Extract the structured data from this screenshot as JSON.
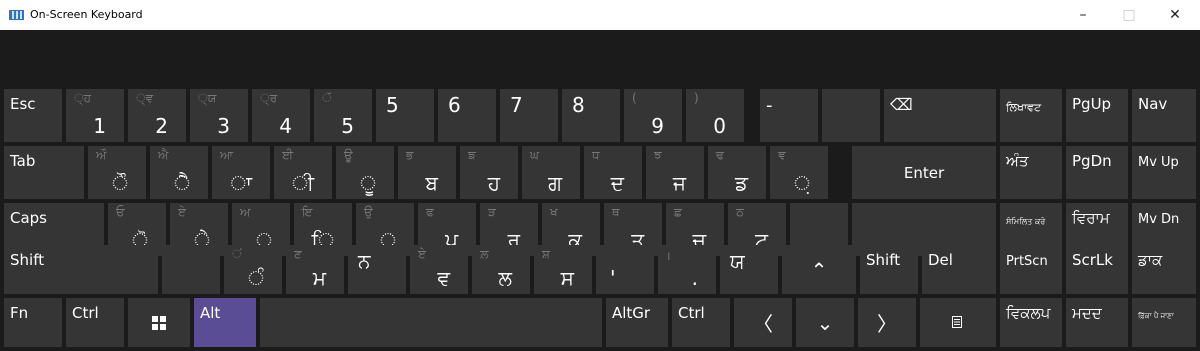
{
  "window": {
    "title": "On-Screen Keyboard",
    "minimize_glyph": "–",
    "maximize_glyph": "□",
    "close_glyph": "✕"
  },
  "keys": {
    "esc": "Esc",
    "digits": [
      {
        "shift": "੍ਹ",
        "main": "1"
      },
      {
        "shift": "੍ਵ",
        "main": "2"
      },
      {
        "shift": "੍ਯ",
        "main": "3"
      },
      {
        "shift": "੍ਰ",
        "main": "4"
      },
      {
        "shift": "ੱ",
        "main": "5"
      }
    ],
    "digits2": [
      {
        "main": "5"
      },
      {
        "main": "6"
      },
      {
        "main": "7"
      },
      {
        "main": "8"
      }
    ],
    "paren_open": "(",
    "nine": "9",
    "paren_close": ")",
    "zero": "0",
    "minus": "-",
    "tab": "Tab",
    "row2": [
      {
        "shift": "ਔ",
        "main": "ੌ"
      },
      {
        "shift": "ਐ",
        "main": "ੈ"
      },
      {
        "shift": "ਆ",
        "main": "ਾ"
      },
      {
        "shift": "ਈ",
        "main": "ੀ"
      },
      {
        "shift": "ਊ",
        "main": "ੂ"
      },
      {
        "shift": "ਭ",
        "main": "ਬ"
      },
      {
        "shift": "ਙ",
        "main": "ਹ"
      },
      {
        "shift": "ਘ",
        "main": "ਗ"
      },
      {
        "shift": "ਧ",
        "main": "ਦ"
      },
      {
        "shift": "ਝ",
        "main": "ਜ"
      },
      {
        "shift": "ਢ",
        "main": "ਡ"
      },
      {
        "shift": "ਞ",
        "main": "਼"
      }
    ],
    "enter": "Enter",
    "caps": "Caps",
    "row3": [
      {
        "shift": "ਓ",
        "main": "ੋ"
      },
      {
        "shift": "ਏ",
        "main": "ੇ"
      },
      {
        "shift": "ਅ",
        "main": "੍"
      },
      {
        "shift": "ਇ",
        "main": "ਿ"
      },
      {
        "shift": "ਉ",
        "main": "ੁ"
      },
      {
        "shift": "ਫ",
        "main": "ਪ"
      },
      {
        "shift": "ੜ",
        "main": "ਰ"
      },
      {
        "shift": "ਖ",
        "main": "ਕ"
      },
      {
        "shift": "ਥ",
        "main": "ਤ"
      },
      {
        "shift": "ਛ",
        "main": "ਚ"
      },
      {
        "shift": "ਠ",
        "main": "ਟ"
      }
    ],
    "shift": "Shift",
    "row4": [
      {
        "shift": "ਂ",
        "main": "ੰ"
      },
      {
        "shift": "ਣ",
        "main": "ਮ"
      },
      {
        "shift": "",
        "main": "ਨ"
      },
      {
        "shift": "ਏ",
        "main": "ਵ"
      },
      {
        "shift": "ਲ਼",
        "main": "ਲ"
      },
      {
        "shift": "ਸ਼",
        "main": "ਸ"
      },
      {
        "shift": "",
        "main": "'"
      },
      {
        "shift": "।",
        "main": "."
      },
      {
        "shift": "",
        "main": "ਯ"
      }
    ],
    "shift_right": "Shift",
    "del": "Del",
    "fn": "Fn",
    "ctrl": "Ctrl",
    "alt": "Alt",
    "altgr": "AltGr",
    "ctrl_right": "Ctrl",
    "up_glyph": "⌃",
    "down_glyph": "⌄",
    "left_glyph": "〈",
    "right_glyph": "〉",
    "backspace_glyph": "⌫"
  },
  "side": {
    "likhavat": "ਲਿਖਾਵਟ",
    "pgup": "PgUp",
    "nav": "Nav",
    "ant": "ਅੰਤ",
    "pgdn": "PgDn",
    "mvup": "Mv Up",
    "sammilit": "ਸੰਮਿਲਿਤ ਕਰੋ",
    "viram": "ਵਿਰਾਮ",
    "mvdn": "Mv Dn",
    "prtscn": "PrtScn",
    "scrlk": "ScrLk",
    "dak": "ਡਾਕ",
    "vikalap": "ਵਿਕਲਪ",
    "madad": "ਮਦਦ",
    "fika": "ਫ਼ਿੱਕਾ ਪੈ ਜਾਣਾ"
  },
  "colors": {
    "background": "#1b1b1b",
    "key": "#353535",
    "active_key": "#5b4c96",
    "secondary_text": "#777777"
  }
}
